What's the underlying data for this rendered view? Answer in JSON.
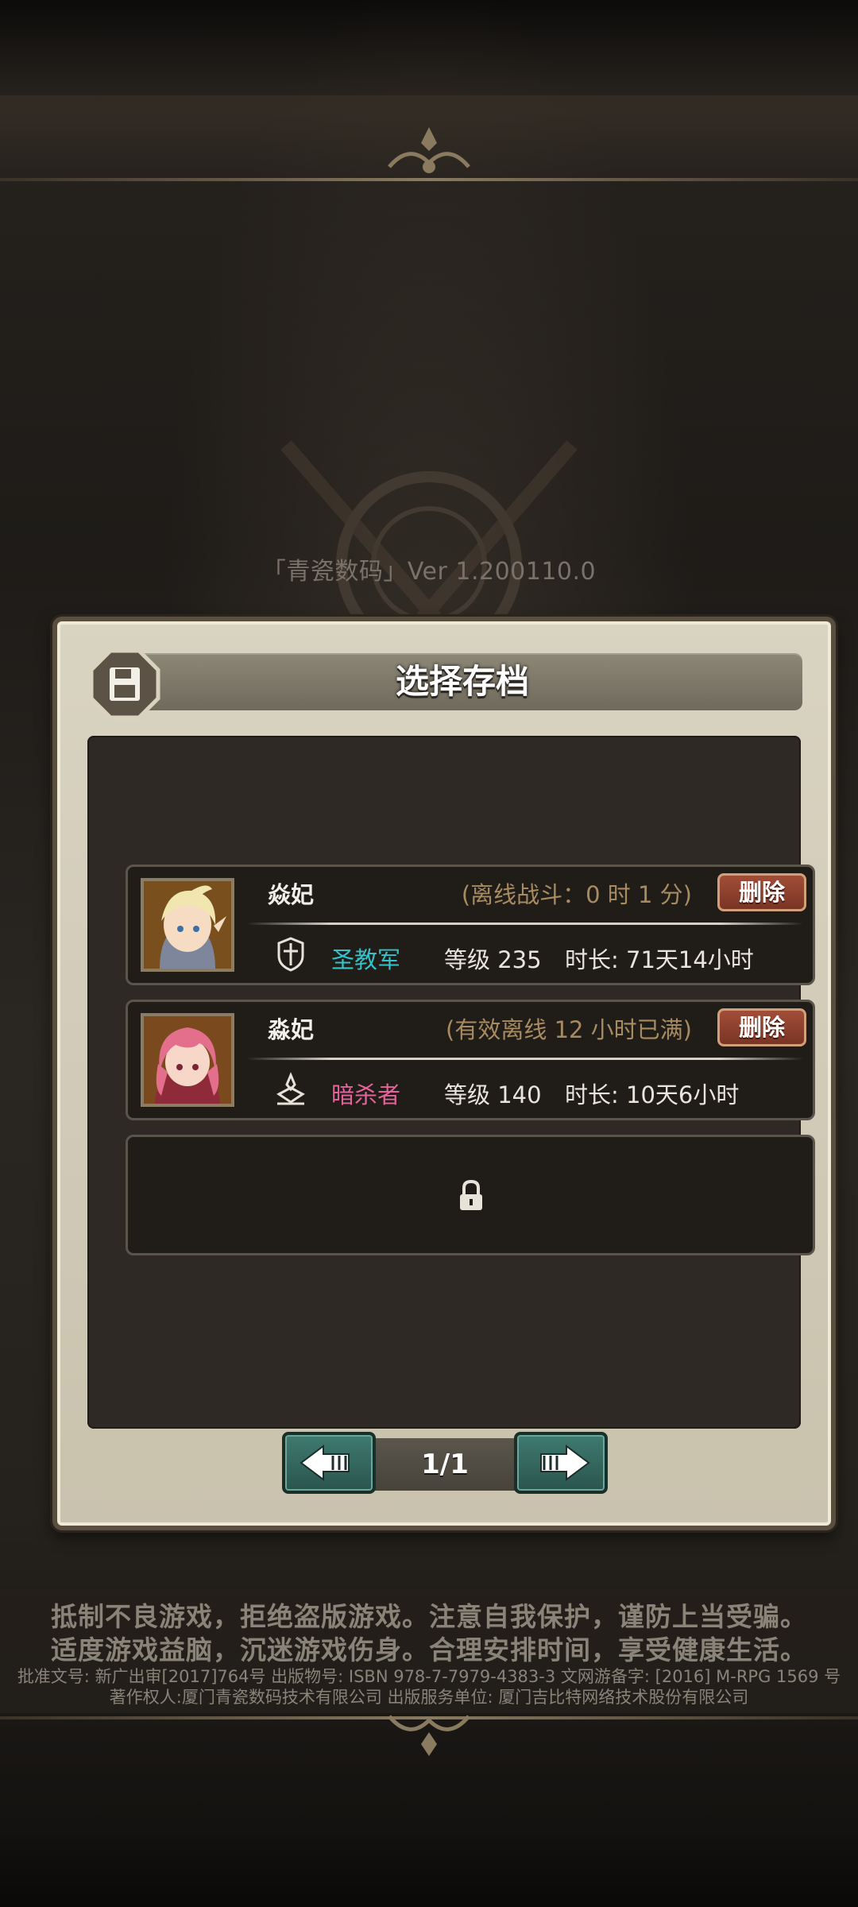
{
  "version_text": "「青瓷数码」Ver 1.200110.0",
  "dialog": {
    "title": "选择存档",
    "slots": [
      {
        "name": "焱妃",
        "offline_status": "(离线战斗：0 时 1 分)",
        "delete_label": "删除",
        "class_name": "圣教军",
        "class_color": "#36c2c8",
        "level": "等级 235",
        "playtime": "时长: 71天14小时",
        "class_icon": "cross-shield-icon"
      },
      {
        "name": "淼妃",
        "offline_status": "(有效离线 12 小时已满)",
        "delete_label": "删除",
        "class_name": "暗杀者",
        "class_color": "#e2649b",
        "level": "等级 140",
        "playtime": "时长: 10天6小时",
        "class_icon": "dagger-emblem-icon"
      },
      {
        "locked": true,
        "icon": "lock-icon"
      }
    ],
    "pagination": {
      "current": "1/1",
      "prev_icon": "left-arrow-icon",
      "next_icon": "right-arrow-icon"
    }
  },
  "notice": {
    "line1": "抵制不良游戏，拒绝盗版游戏。注意自我保护，谨防上当受骗。",
    "line2": "适度游戏益脑，沉迷游戏伤身。合理安排时间，享受健康生活。",
    "line3": "批准文号: 新广出审[2017]764号 出版物号: ISBN 978-7-7979-4383-3 文网游备字: [2016] M-RPG 1569 号",
    "line4": "著作权人:厦门青瓷数码技术有限公司 出版服务单位: 厦门吉比特网络技术股份有限公司"
  }
}
